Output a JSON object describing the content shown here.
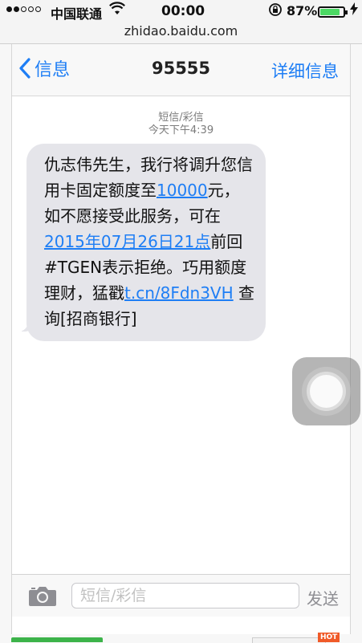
{
  "status_bar": {
    "carrier": "中国联通",
    "time": "00:00",
    "battery": "87%",
    "battery_level": 0.87,
    "signal_bars_filled": 2,
    "signal_bars_total": 5,
    "icons": [
      "wifi-icon",
      "rotation-lock-icon",
      "battery-icon",
      "charging-icon"
    ]
  },
  "browser": {
    "url": "zhidao.baidu.com"
  },
  "nav": {
    "back_label": "信息",
    "title": "95555",
    "details_label": "详细信息"
  },
  "thread": {
    "type_label": "短信/彩信",
    "timestamp": "今天下午4:39"
  },
  "message": {
    "parts": [
      {
        "text": "仇志伟先生，我行将调升您信用卡固定额度至",
        "link": false
      },
      {
        "text": "10000",
        "link": true
      },
      {
        "text": "元，如不愿接受此服务，可在",
        "link": false
      },
      {
        "text": "2015年07月26日21点",
        "link": true
      },
      {
        "text": "前回#TGEN表示拒绝。巧用额度理财，猛戳",
        "link": false
      },
      {
        "text": "t.cn/8Fdn3VH",
        "link": true
      },
      {
        "text": " 查询[招商银行]",
        "link": false
      }
    ]
  },
  "composer": {
    "placeholder": "短信/彩信",
    "send_label": "发送"
  },
  "badge": {
    "hot": "HOT"
  },
  "colors": {
    "accent": "#1e7ef5",
    "bubble": "#e5e5ea",
    "battery_fill": "#4cd964"
  }
}
